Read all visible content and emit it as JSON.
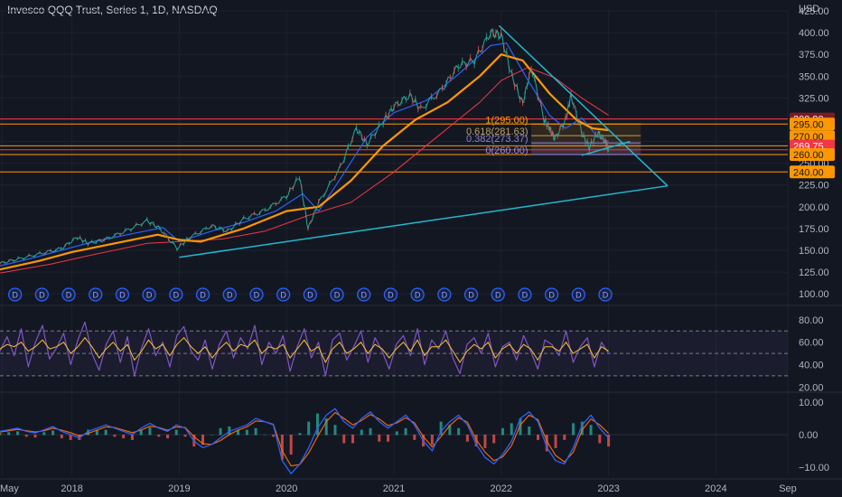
{
  "header": {
    "title": "Invesco QQQ Trust, Series 1, 1D, NASDAQ",
    "currency": "USD"
  },
  "colors": {
    "background": "#131722",
    "grid": "#1e222d",
    "price": "#26a69a",
    "ma_fast": "#2962ff",
    "ma_mid": "#ff9800",
    "ma_slow": "#f23645",
    "trendline": "#22b8cf",
    "hline": "#ff9800",
    "rsi": "#7e57c2",
    "rsi_signal": "#fbc02d",
    "macd": "#2962ff",
    "macd_signal": "#ff6d00",
    "hist_up": "#26a69a",
    "hist_down": "#ef5350",
    "dividend": "#2962ff"
  },
  "chart_data": [
    {
      "panel": "price",
      "type": "line",
      "x_range": [
        2017.33,
        2024.67
      ],
      "ylim": [
        95,
        425
      ],
      "y_ticks": [
        "425.00",
        "400.00",
        "375.00",
        "350.00",
        "325.00",
        "300.00",
        "275.00",
        "250.00",
        "225.00",
        "200.00",
        "175.00",
        "150.00",
        "125.00",
        "100.00"
      ],
      "x_ticks": [
        {
          "x": 2017.35,
          "label": "May"
        },
        {
          "x": 2018.0,
          "label": "2018"
        },
        {
          "x": 2019.0,
          "label": "2019"
        },
        {
          "x": 2020.0,
          "label": "2020"
        },
        {
          "x": 2021.0,
          "label": "2021"
        },
        {
          "x": 2022.0,
          "label": "2022"
        },
        {
          "x": 2023.0,
          "label": "2023"
        },
        {
          "x": 2024.0,
          "label": "2024"
        },
        {
          "x": 2024.67,
          "label": "Sep"
        }
      ],
      "series": [
        {
          "role": "price",
          "points": [
            [
              2017.33,
              135
            ],
            [
              2017.5,
              140
            ],
            [
              2017.7,
              146
            ],
            [
              2017.9,
              152
            ],
            [
              2018.05,
              165
            ],
            [
              2018.15,
              158
            ],
            [
              2018.3,
              162
            ],
            [
              2018.5,
              172
            ],
            [
              2018.7,
              184
            ],
            [
              2018.82,
              175
            ],
            [
              2018.98,
              152
            ],
            [
              2019.1,
              165
            ],
            [
              2019.3,
              178
            ],
            [
              2019.45,
              172
            ],
            [
              2019.6,
              186
            ],
            [
              2019.8,
              196
            ],
            [
              2020.0,
              212
            ],
            [
              2020.12,
              235
            ],
            [
              2020.2,
              175
            ],
            [
              2020.3,
              205
            ],
            [
              2020.5,
              245
            ],
            [
              2020.65,
              290
            ],
            [
              2020.75,
              272
            ],
            [
              2020.9,
              298
            ],
            [
              2021.0,
              315
            ],
            [
              2021.15,
              328
            ],
            [
              2021.25,
              312
            ],
            [
              2021.45,
              335
            ],
            [
              2021.6,
              362
            ],
            [
              2021.75,
              368
            ],
            [
              2021.9,
              400
            ],
            [
              2022.0,
              397
            ],
            [
              2022.1,
              350
            ],
            [
              2022.2,
              318
            ],
            [
              2022.28,
              360
            ],
            [
              2022.4,
              300
            ],
            [
              2022.45,
              290
            ],
            [
              2022.5,
              278
            ],
            [
              2022.6,
              300
            ],
            [
              2022.65,
              328
            ],
            [
              2022.75,
              285
            ],
            [
              2022.82,
              268
            ],
            [
              2022.9,
              285
            ],
            [
              2022.97,
              275
            ],
            [
              2023.0,
              266
            ]
          ]
        },
        {
          "role": "ma_fast",
          "points": [
            [
              2017.33,
              132
            ],
            [
              2017.6,
              140
            ],
            [
              2017.9,
              150
            ],
            [
              2018.2,
              160
            ],
            [
              2018.6,
              170
            ],
            [
              2018.85,
              176
            ],
            [
              2019.0,
              160
            ],
            [
              2019.3,
              172
            ],
            [
              2019.6,
              182
            ],
            [
              2019.9,
              195
            ],
            [
              2020.15,
              215
            ],
            [
              2020.3,
              195
            ],
            [
              2020.5,
              232
            ],
            [
              2020.75,
              280
            ],
            [
              2021.0,
              308
            ],
            [
              2021.3,
              322
            ],
            [
              2021.6,
              352
            ],
            [
              2021.9,
              385
            ],
            [
              2022.05,
              388
            ],
            [
              2022.25,
              345
            ],
            [
              2022.45,
              305
            ],
            [
              2022.6,
              290
            ],
            [
              2022.75,
              302
            ],
            [
              2022.9,
              280
            ],
            [
              2023.0,
              275
            ]
          ]
        },
        {
          "role": "ma_mid",
          "points": [
            [
              2017.33,
              128
            ],
            [
              2017.7,
              138
            ],
            [
              2018.0,
              148
            ],
            [
              2018.4,
              158
            ],
            [
              2018.8,
              168
            ],
            [
              2019.0,
              162
            ],
            [
              2019.2,
              160
            ],
            [
              2019.6,
              175
            ],
            [
              2020.0,
              195
            ],
            [
              2020.3,
              200
            ],
            [
              2020.6,
              230
            ],
            [
              2020.9,
              270
            ],
            [
              2021.2,
              300
            ],
            [
              2021.5,
              320
            ],
            [
              2021.8,
              350
            ],
            [
              2022.0,
              375
            ],
            [
              2022.2,
              368
            ],
            [
              2022.45,
              330
            ],
            [
              2022.7,
              300
            ],
            [
              2022.85,
              290
            ],
            [
              2023.0,
              288
            ]
          ]
        },
        {
          "role": "ma_slow",
          "points": [
            [
              2017.33,
              124
            ],
            [
              2017.8,
              134
            ],
            [
              2018.2,
              145
            ],
            [
              2018.7,
              158
            ],
            [
              2019.0,
              160
            ],
            [
              2019.4,
              163
            ],
            [
              2019.8,
              172
            ],
            [
              2020.2,
              190
            ],
            [
              2020.6,
              205
            ],
            [
              2021.0,
              240
            ],
            [
              2021.4,
              280
            ],
            [
              2021.8,
              320
            ],
            [
              2022.0,
              345
            ],
            [
              2022.25,
              360
            ],
            [
              2022.5,
              348
            ],
            [
              2022.75,
              325
            ],
            [
              2023.0,
              305
            ]
          ]
        }
      ],
      "trendlines": [
        {
          "points": [
            [
              2019.0,
              142
            ],
            [
              2023.55,
              224
            ]
          ]
        },
        {
          "points": [
            [
              2021.98,
              408
            ],
            [
              2023.55,
              224
            ]
          ]
        },
        {
          "points": [
            [
              2022.75,
              259
            ],
            [
              2023.2,
              275
            ]
          ]
        }
      ],
      "horizontal_levels": [
        {
          "value": 300.9,
          "color": "#f23645"
        },
        {
          "value": 295.0,
          "color": "#ff9800"
        },
        {
          "value": 270.0,
          "color": "#ff9800"
        },
        {
          "value": 265.5,
          "color": "#f23645"
        },
        {
          "value": 260.0,
          "color": "#ff9800"
        },
        {
          "value": 240.0,
          "color": "#ff9800"
        }
      ],
      "fib_levels": [
        {
          "value": 295.0,
          "label": "1(295.00)",
          "color": "#ff9800"
        },
        {
          "value": 281.63,
          "label": "0.618(281.63)",
          "color": "#c0a060"
        },
        {
          "value": 273.37,
          "label": "0.382(273.37)",
          "color": "#8e84d8"
        },
        {
          "value": 260.0,
          "label": "0(260.00)",
          "color": "#9b8ae0"
        }
      ],
      "fib_x_range": [
        2022.28,
        2023.3
      ],
      "price_labels": [
        {
          "value": 300.9,
          "label": "300.90",
          "bg": "#7a1c24",
          "fg": "#ffffff"
        },
        {
          "value": 295.0,
          "label": "295.00",
          "bg": "#ff9800",
          "fg": "#131722"
        },
        {
          "value": 280.5,
          "label": "270.00",
          "bg": "#ff9800",
          "fg": "#131722"
        },
        {
          "value": 269.75,
          "label": "269.75",
          "bg": "#f23645",
          "fg": "#ffffff"
        },
        {
          "value": 260.0,
          "label": "260.00",
          "bg": "#ff9800",
          "fg": "#131722"
        },
        {
          "value": 240.0,
          "label": "240.00",
          "bg": "#ff9800",
          "fg": "#131722"
        }
      ],
      "dividend_label": "D",
      "dividend_x": [
        2017.47,
        2017.72,
        2017.97,
        2018.22,
        2018.47,
        2018.72,
        2018.97,
        2019.22,
        2019.47,
        2019.72,
        2019.97,
        2020.22,
        2020.47,
        2020.72,
        2020.97,
        2021.22,
        2021.47,
        2021.72,
        2021.97,
        2022.22,
        2022.47,
        2022.72,
        2022.97
      ]
    },
    {
      "panel": "rsi",
      "type": "line",
      "ylim": [
        17,
        88
      ],
      "y_ticks": [
        "80.00",
        "60.00",
        "40.00",
        "20.00"
      ],
      "bands": [
        70,
        50,
        30
      ],
      "series": [
        {
          "role": "rsi",
          "values": [
            52,
            65,
            48,
            72,
            38,
            60,
            75,
            45,
            55,
            68,
            40,
            62,
            78,
            50,
            35,
            58,
            70,
            42,
            65,
            30,
            55,
            72,
            48,
            60,
            38,
            66,
            74,
            52,
            44,
            62,
            36,
            58,
            70,
            46,
            64,
            54,
            75,
            40,
            60,
            50,
            66,
            34,
            56,
            72,
            46,
            60,
            30,
            62,
            68,
            44,
            56,
            70,
            42,
            64,
            52,
            36,
            58,
            66,
            48,
            72,
            40,
            62,
            54,
            70,
            46,
            32,
            58,
            64,
            50,
            68,
            38,
            56,
            60,
            44,
            66,
            52,
            36,
            62,
            58,
            48,
            70,
            42,
            56,
            64,
            38,
            60,
            50
          ]
        },
        {
          "role": "rsi_signal",
          "values": [
            54,
            58,
            56,
            60,
            52,
            56,
            62,
            54,
            56,
            60,
            50,
            56,
            64,
            56,
            46,
            54,
            60,
            52,
            58,
            44,
            52,
            62,
            54,
            58,
            48,
            58,
            64,
            56,
            50,
            56,
            46,
            54,
            60,
            52,
            58,
            56,
            62,
            50,
            56,
            54,
            58,
            46,
            54,
            62,
            52,
            56,
            42,
            54,
            60,
            50,
            54,
            60,
            50,
            58,
            54,
            46,
            54,
            60,
            52,
            62,
            48,
            56,
            56,
            62,
            52,
            42,
            52,
            58,
            54,
            60,
            46,
            54,
            58,
            50,
            58,
            54,
            44,
            56,
            56,
            52,
            60,
            50,
            54,
            58,
            46,
            56,
            52
          ]
        }
      ]
    },
    {
      "panel": "macd",
      "type": "line",
      "ylim": [
        -12.5,
        12.5
      ],
      "y_ticks": [
        "10.00",
        "0.00",
        "−10.00"
      ],
      "series": [
        {
          "role": "macd",
          "values": [
            1,
            1.5,
            2,
            1,
            0.5,
            1.5,
            2.5,
            1,
            0,
            -1,
            1,
            2,
            3,
            2,
            1,
            0,
            2,
            3.5,
            2,
            1,
            3,
            2,
            -2,
            -4,
            -3,
            -1,
            1,
            2,
            3,
            5,
            4,
            3,
            -8,
            -12,
            -9,
            -4,
            2,
            6,
            8,
            4,
            2,
            5,
            7,
            4,
            2,
            4,
            6,
            3,
            -2,
            -5,
            1,
            4,
            6,
            3,
            -3,
            -7,
            -9,
            -6,
            -2,
            5,
            7,
            4,
            -4,
            -8,
            -9,
            -4,
            3,
            6,
            2,
            -1
          ]
        },
        {
          "role": "macd_signal",
          "values": [
            0.8,
            1.2,
            1.6,
            1.2,
            0.8,
            1.2,
            2,
            1.4,
            0.6,
            -0.4,
            0.4,
            1.4,
            2.4,
            2.2,
            1.4,
            0.6,
            1.4,
            2.6,
            2.2,
            1.4,
            2.4,
            2.2,
            -0.6,
            -2.8,
            -3,
            -1.8,
            0,
            1.4,
            2.4,
            4.2,
            4,
            3.2,
            -5,
            -9.6,
            -9.2,
            -5.6,
            -0.6,
            4,
            6.8,
            5,
            3,
            4.4,
            6.2,
            4.8,
            2.8,
            3.6,
            5.2,
            3.6,
            -0.6,
            -3.8,
            -0.6,
            2.8,
            5.2,
            3.8,
            -1.6,
            -5.4,
            -8,
            -6.8,
            -3.4,
            3,
            6,
            4.6,
            -2,
            -6.4,
            -8.4,
            -5.4,
            1.4,
            4.8,
            3,
            0.4
          ]
        }
      ]
    }
  ]
}
